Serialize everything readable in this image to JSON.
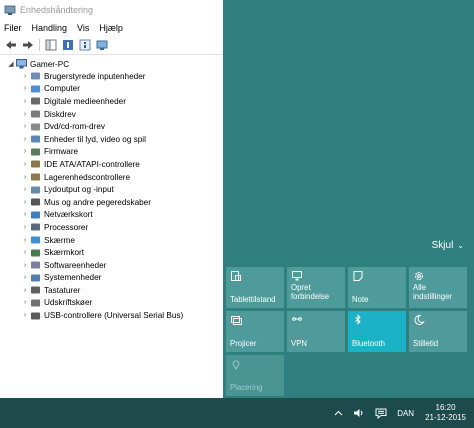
{
  "window": {
    "title": "Enhedshåndtering",
    "menu": [
      "Filer",
      "Handling",
      "Vis",
      "Hjælp"
    ],
    "tree": {
      "root": "Gamer-PC",
      "items": [
        {
          "label": "Brugerstyrede inputenheder",
          "icon": "hid-icon"
        },
        {
          "label": "Computer",
          "icon": "computer-icon"
        },
        {
          "label": "Digitale medieenheder",
          "icon": "media-device-icon"
        },
        {
          "label": "Diskdrev",
          "icon": "disk-drive-icon"
        },
        {
          "label": "Dvd/cd-rom-drev",
          "icon": "dvd-drive-icon"
        },
        {
          "label": "Enheder til lyd, video og spil",
          "icon": "sound-icon"
        },
        {
          "label": "Firmware",
          "icon": "firmware-icon"
        },
        {
          "label": "IDE ATA/ATAPI-controllere",
          "icon": "ide-controller-icon"
        },
        {
          "label": "Lagerenhedscontrollere",
          "icon": "storage-controller-icon"
        },
        {
          "label": "Lydoutput og -input",
          "icon": "audio-io-icon"
        },
        {
          "label": "Mus og andre pegeredskaber",
          "icon": "mouse-icon"
        },
        {
          "label": "Netværkskort",
          "icon": "network-adapter-icon"
        },
        {
          "label": "Processorer",
          "icon": "processor-icon"
        },
        {
          "label": "Skærme",
          "icon": "monitor-icon"
        },
        {
          "label": "Skærmkort",
          "icon": "display-adapter-icon"
        },
        {
          "label": "Softwareenheder",
          "icon": "software-device-icon"
        },
        {
          "label": "Systemenheder",
          "icon": "system-device-icon"
        },
        {
          "label": "Tastaturer",
          "icon": "keyboard-icon"
        },
        {
          "label": "Udskriftskøer",
          "icon": "print-queue-icon"
        },
        {
          "label": "USB-controllere (Universal Serial Bus)",
          "icon": "usb-icon"
        }
      ]
    }
  },
  "action_center": {
    "collapse_label": "Skjul",
    "tiles": [
      {
        "label": "Tablettilstand",
        "icon": "tablet-mode-icon",
        "state": "off"
      },
      {
        "label_line1": "Opret",
        "label_line2": "forbindelse",
        "icon": "connect-icon",
        "state": "off"
      },
      {
        "label": "Note",
        "icon": "note-icon",
        "state": "off"
      },
      {
        "label_line1": "Alle",
        "label_line2": "indstillinger",
        "icon": "settings-icon",
        "state": "off"
      },
      {
        "label": "Projicer",
        "icon": "project-icon",
        "state": "off"
      },
      {
        "label": "VPN",
        "icon": "vpn-icon",
        "state": "off"
      },
      {
        "label": "Bluetooth",
        "icon": "bluetooth-icon",
        "state": "on"
      },
      {
        "label": "Stilletid",
        "icon": "quiet-hours-icon",
        "state": "off"
      },
      {
        "label": "Placering",
        "icon": "location-icon",
        "state": "disabled"
      }
    ]
  },
  "taskbar": {
    "language": "DAN",
    "time": "16:20",
    "date": "21-12-2015"
  },
  "colors": {
    "accent_bg": "#2f7f7f",
    "tile": "#4f9a9a",
    "tile_active": "#1bb2c7",
    "taskbar": "#1d4a4a"
  }
}
